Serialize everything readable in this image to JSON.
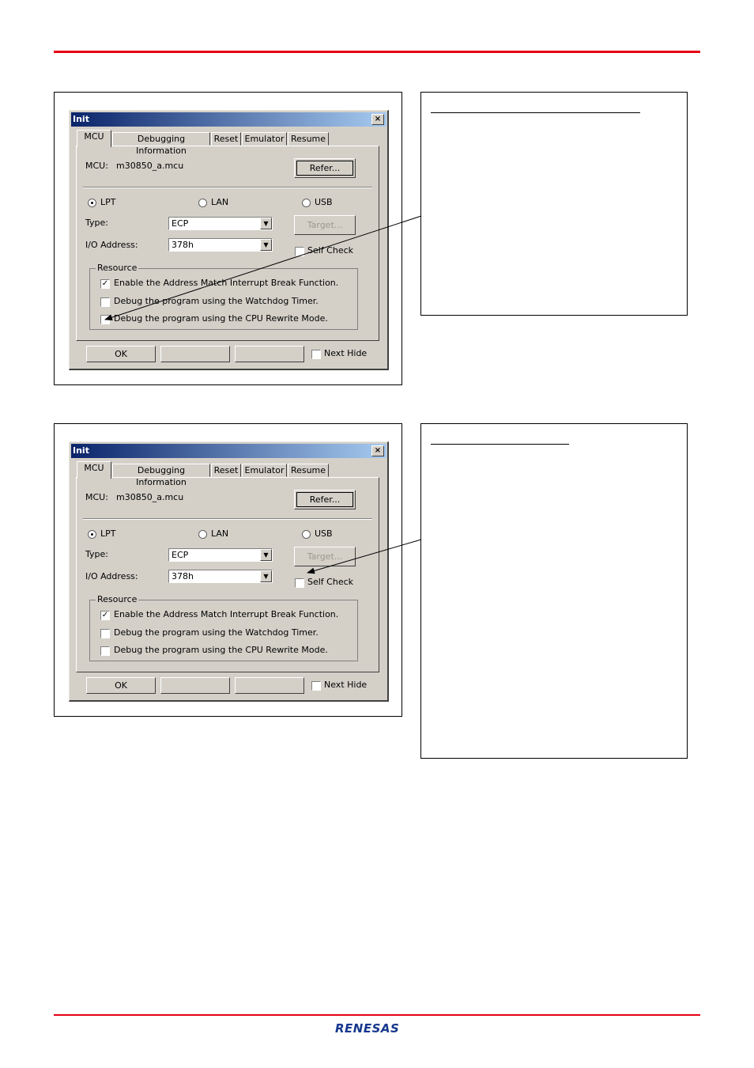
{
  "dialogs": [
    {
      "title": "Init",
      "close_glyph": "×",
      "tabs": [
        "MCU",
        "Debugging Information",
        "Reset",
        "Emulator",
        "Resume"
      ],
      "mcu_label": "MCU:",
      "mcu_value": "m30850_a.mcu",
      "refer_label": "Refer...",
      "radios": [
        {
          "label": "LPT",
          "selected": true
        },
        {
          "label": "LAN",
          "selected": false
        },
        {
          "label": "USB",
          "selected": false
        }
      ],
      "type_label": "Type:",
      "type_value": "ECP",
      "io_label": "I/O Address:",
      "io_value": "378h",
      "target_label": "Target...",
      "self_check_label": "Self Check",
      "self_check_checked": false,
      "resource_legend": "Resource",
      "resource_items": [
        {
          "label": "Enable the Address Match Interrupt Break Function.",
          "checked": true
        },
        {
          "label": "Debug the program using the Watchdog Timer.",
          "checked": false
        },
        {
          "label": "Debug the program using the CPU Rewrite Mode.",
          "checked": false
        }
      ],
      "ok_label": "OK",
      "next_hide_label": "Next Hide",
      "next_hide_checked": false
    },
    {
      "title": "Init",
      "close_glyph": "×",
      "tabs": [
        "MCU",
        "Debugging Information",
        "Reset",
        "Emulator",
        "Resume"
      ],
      "mcu_label": "MCU:",
      "mcu_value": "m30850_a.mcu",
      "refer_label": "Refer...",
      "radios": [
        {
          "label": "LPT",
          "selected": true
        },
        {
          "label": "LAN",
          "selected": false
        },
        {
          "label": "USB",
          "selected": false
        }
      ],
      "type_label": "Type:",
      "type_value": "ECP",
      "io_label": "I/O Address:",
      "io_value": "378h",
      "target_label": "Target...",
      "self_check_label": "Self Check",
      "self_check_checked": false,
      "resource_legend": "Resource",
      "resource_items": [
        {
          "label": "Enable the Address Match Interrupt Break Function.",
          "checked": true
        },
        {
          "label": "Debug the program using the Watchdog Timer.",
          "checked": false
        },
        {
          "label": "Debug the program using the CPU Rewrite Mode.",
          "checked": false
        }
      ],
      "ok_label": "OK",
      "next_hide_label": "Next Hide",
      "next_hide_checked": false
    }
  ],
  "logo_text": "RENESAS",
  "colors": {
    "accent_red": "#e60012",
    "title_gradient_start": "#0a246a",
    "title_gradient_end": "#a6caf0",
    "logo_blue": "#16378e"
  }
}
